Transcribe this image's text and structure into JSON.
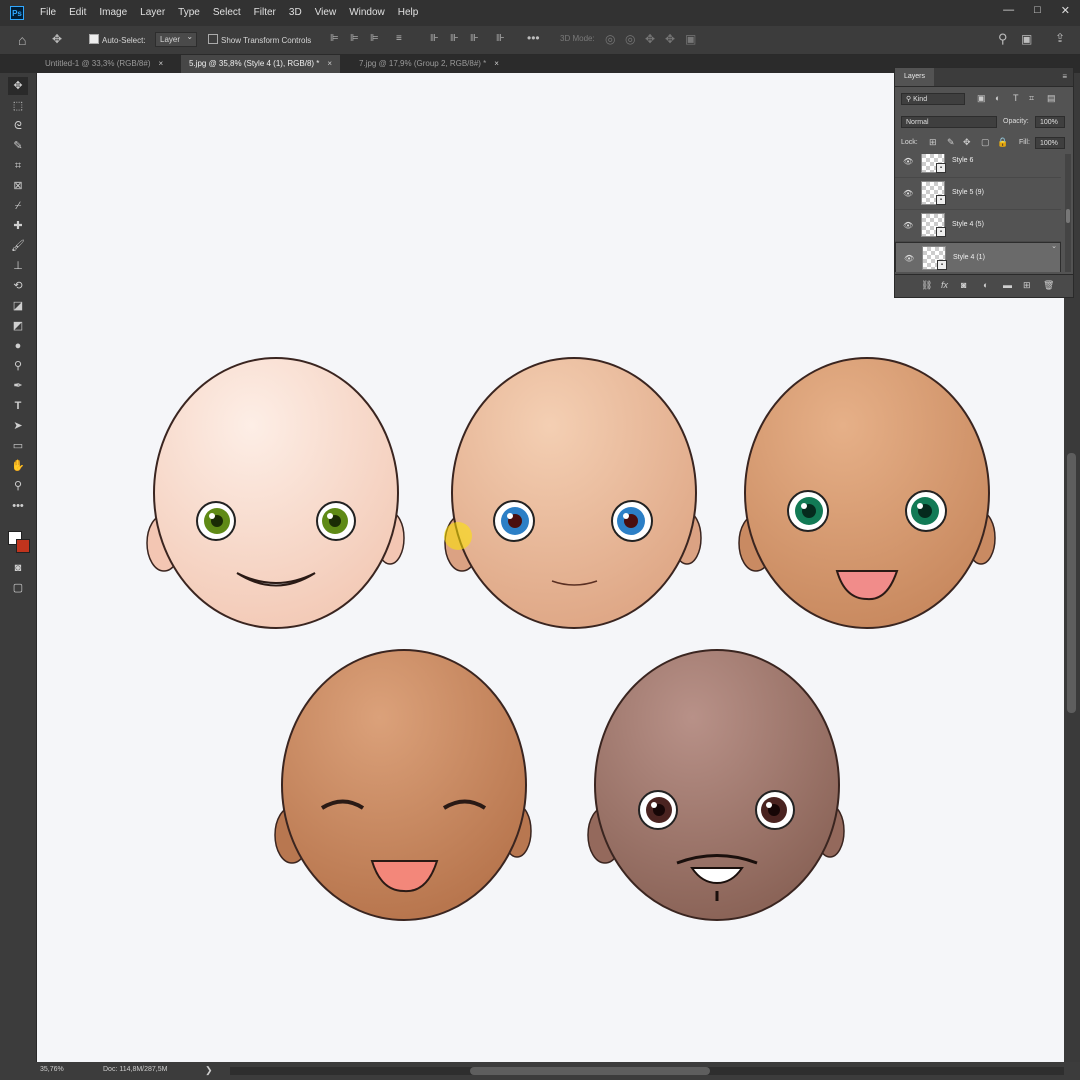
{
  "app": {
    "logo": "Ps"
  },
  "menu": [
    "File",
    "Edit",
    "Image",
    "Layer",
    "Type",
    "Select",
    "Filter",
    "3D",
    "View",
    "Window",
    "Help"
  ],
  "window_controls": {
    "minimize": "—",
    "maximize": "□",
    "close": "✕"
  },
  "options": {
    "auto_select_label": "Auto-Select:",
    "auto_select_target": "Layer",
    "show_transform_label": "Show Transform Controls",
    "mode_3d_label": "3D Mode:"
  },
  "tabs": [
    {
      "label": "Untitled-1 @ 33,3% (RGB/8#)",
      "close": "×"
    },
    {
      "label": "5.jpg @ 35,8% (Style 4 (1), RGB/8) *",
      "close": "×"
    },
    {
      "label": "7.jpg @ 17,9% (Group 2, RGB/8#) *",
      "close": "×"
    }
  ],
  "layers_panel": {
    "title": "Layers",
    "filter_kind": "Kind",
    "blend_mode": "Normal",
    "opacity_label": "Opacity:",
    "opacity_value": "100%",
    "lock_label": "Lock:",
    "fill_label": "Fill:",
    "fill_value": "100%",
    "layers": [
      {
        "name": "Style 6",
        "visible": true,
        "selected": false
      },
      {
        "name": "Style 5 (9)",
        "visible": true,
        "selected": false
      },
      {
        "name": "Style 4 (5)",
        "visible": true,
        "selected": false
      },
      {
        "name": "Style 4 (1)",
        "visible": true,
        "selected": true
      }
    ]
  },
  "status": {
    "zoom": "35,76%",
    "doc": "Doc: 114,8M/287,5M",
    "arrow": "❯"
  },
  "colors": {
    "skin1": "#f8d7c8",
    "skin2": "#e9b592",
    "skin3": "#d59a6e",
    "skin4": "#c78358",
    "skin5": "#9a7063"
  },
  "icons": {
    "home": "home-icon",
    "move": "move-icon",
    "search": "search-icon",
    "workspace": "workspace-icon",
    "share": "share-icon",
    "eye": "eye-icon"
  }
}
